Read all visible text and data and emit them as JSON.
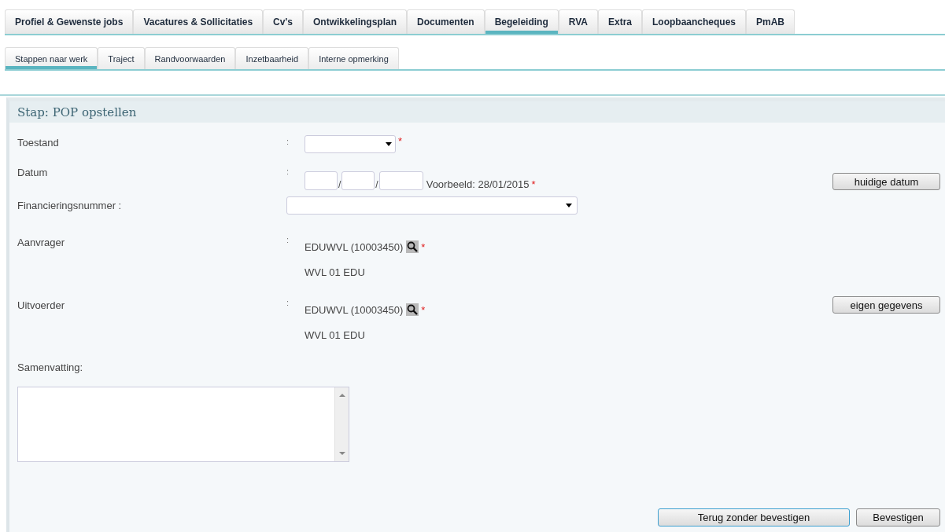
{
  "tabs": [
    {
      "label": "Profiel & Gewenste jobs",
      "selected": false
    },
    {
      "label": "Vacatures & Sollicitaties",
      "selected": false
    },
    {
      "label": "Cv's",
      "selected": false
    },
    {
      "label": "Ontwikkelingsplan",
      "selected": false
    },
    {
      "label": "Documenten",
      "selected": false
    },
    {
      "label": "Begeleiding",
      "selected": true
    },
    {
      "label": "RVA",
      "selected": false
    },
    {
      "label": "Extra",
      "selected": false
    },
    {
      "label": "Loopbaancheques",
      "selected": false
    },
    {
      "label": "PmAB",
      "selected": false
    }
  ],
  "subtabs": [
    {
      "label": "Stappen naar werk",
      "selected": true
    },
    {
      "label": "Traject",
      "selected": false
    },
    {
      "label": "Randvoorwaarden",
      "selected": false
    },
    {
      "label": "Inzetbaarheid",
      "selected": false
    },
    {
      "label": "Interne opmerking",
      "selected": false
    }
  ],
  "section": {
    "title": "Stap: POP opstellen",
    "rows": [
      {
        "kind": "select",
        "label": "Toestand",
        "separator": ":",
        "required_mark": "*"
      },
      {
        "kind": "date",
        "label": "Datum",
        "separator": ":",
        "date_separators": [
          "/",
          "/"
        ],
        "example": "Voorbeeld: 28/01/2015",
        "required_mark": "*",
        "button": "huidige datum"
      },
      {
        "kind": "wide-select",
        "label": "Financieringsnummer :"
      },
      {
        "kind": "person",
        "label": "Aanvrager",
        "separator": ":",
        "value": "EDUWVL (10003450)",
        "required_mark": "*",
        "name": "WVL 01 EDU"
      },
      {
        "kind": "person",
        "label": "Uitvoerder",
        "separator": ":",
        "value": "EDUWVL (10003450)",
        "required_mark": "*",
        "name": "WVL 01 EDU",
        "button": "eigen gegevens"
      }
    ],
    "summary": {
      "label": "Samenvatting:"
    },
    "actions": [
      {
        "label": "Terug zonder bevestigen",
        "focused": true
      },
      {
        "label": "Bevestigen",
        "focused": false
      }
    ]
  }
}
